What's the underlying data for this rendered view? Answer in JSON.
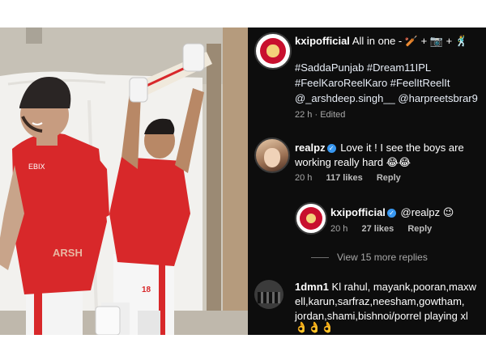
{
  "post": {
    "username": "kxipofficial",
    "caption_text": "All in one - 🏏 + 📷 + 🕺",
    "hashtags_line1": "#SaddaPunjab #Dream11IPL",
    "hashtags_line2": "#FeelKaroReelKaro #FeelItReelIt",
    "mentions_line": "@_arshdeep.singh__ @harpreetsbrar9",
    "time": "22 h",
    "edited": "· Edited"
  },
  "comments": [
    {
      "username": "realpz",
      "verified": true,
      "text_line1": "Love it ! I see the boys are",
      "text_line2": "working really hard 😂😂",
      "time": "20 h",
      "likes": "117 likes",
      "reply": "Reply"
    },
    {
      "username": "kxipofficial",
      "verified": true,
      "text": "@realpz 😉",
      "time": "20 h",
      "likes": "27 likes",
      "reply": "Reply"
    },
    {
      "username": "1dmn1",
      "text_line1": "Kl rahul, mayank,pooran,maxw",
      "text_line2": "ell,karun,sarfraz,neesham,gowtham,",
      "text_line3": "jordan,shami,bishnoi/porrel playing xl",
      "text_line4": "👌👌👌"
    }
  ],
  "view_more": "View 15 more replies",
  "photo": {
    "jersey_text": "ARSH",
    "sponsor_text": "EBIX",
    "jersey_number": "18"
  },
  "colors": {
    "panel_bg": "#0d0d0d",
    "jersey_red": "#d8282a",
    "verified_blue": "#3897f0"
  }
}
